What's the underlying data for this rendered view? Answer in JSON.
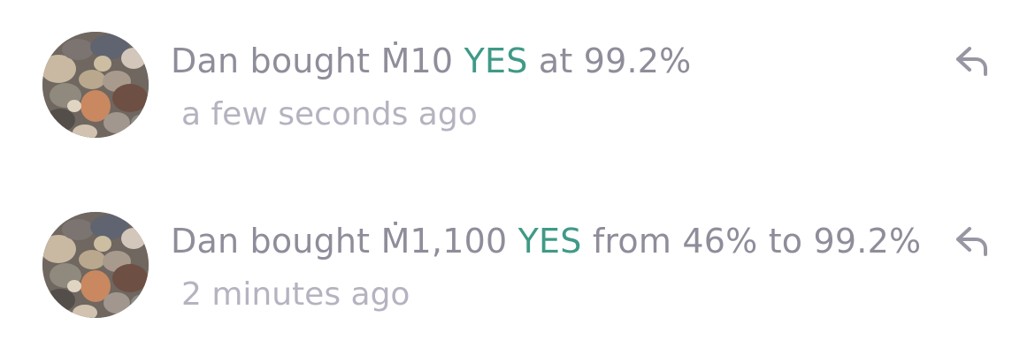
{
  "feed": {
    "items": [
      {
        "user": "Dan",
        "verb": "bought",
        "amount": "Ṁ10",
        "outcome": "YES",
        "price_text": "at 99.2%",
        "time": "a few seconds ago",
        "icon": "reply-icon"
      },
      {
        "user": "Dan",
        "verb": "bought",
        "amount": "Ṁ1,100",
        "outcome": "YES",
        "price_text": "from 46% to 99.2%",
        "time": "2 minutes ago",
        "icon": "reply-icon"
      }
    ]
  },
  "colors": {
    "text": "#8e8d9a",
    "muted": "#b4b3c0",
    "outcome_yes": "#3f9a86"
  }
}
